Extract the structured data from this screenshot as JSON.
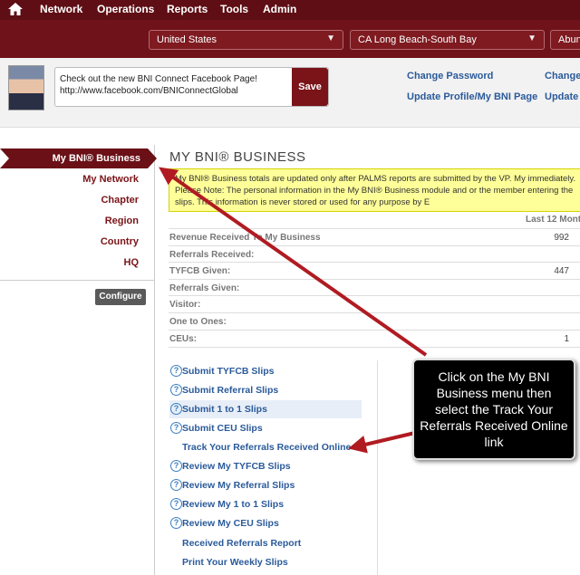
{
  "nav": {
    "items": [
      "Network",
      "Operations",
      "Reports",
      "Tools",
      "Admin"
    ]
  },
  "selectors": [
    {
      "value": "United States"
    },
    {
      "value": "CA Long Beach-South Bay"
    },
    {
      "value": "Abun"
    }
  ],
  "profile": {
    "status_text": "Check out the new BNI Connect Facebook Page!\nhttp://www.facebook.com/BNIConnectGlobal",
    "save_label": "Save",
    "links": [
      "Change Password",
      "Change",
      "Update Profile/My BNI Page",
      "Update I"
    ]
  },
  "sidebar": {
    "active": "My BNI® Business",
    "items": [
      "My Network",
      "Chapter",
      "Region",
      "Country",
      "HQ"
    ],
    "configure_label": "Configure"
  },
  "main": {
    "title": "MY BNI® BUSINESS",
    "notice": "My BNI® Business totals are updated only after PALMS reports are submitted by the VP. My immediately. Please Note: The personal information in the My BNI® Business module and or the member entering the slips. This information is never stored or used for any purpose by E",
    "period_header": "Last 12 Mont",
    "stats": [
      {
        "label": "Revenue Received To My Business",
        "value": "992"
      },
      {
        "label": "Referrals Received:",
        "value": ""
      },
      {
        "label": "TYFCB Given:",
        "value": "447"
      },
      {
        "label": "Referrals Given:",
        "value": ""
      },
      {
        "label": "Visitor:",
        "value": ""
      },
      {
        "label": "One to Ones:",
        "value": ""
      },
      {
        "label": "CEUs:",
        "value": "1"
      }
    ],
    "links": [
      {
        "label": "Submit TYFCB Slips",
        "help": true
      },
      {
        "label": "Submit Referral Slips",
        "help": true
      },
      {
        "label": "Submit 1 to 1 Slips",
        "help": true
      },
      {
        "label": "Submit CEU Slips",
        "help": true
      },
      {
        "label": "Track Your Referrals Received Online",
        "help": false
      },
      {
        "label": "Review My TYFCB Slips",
        "help": true
      },
      {
        "label": "Review My Referral Slips",
        "help": true
      },
      {
        "label": "Review My 1 to 1 Slips",
        "help": true
      },
      {
        "label": "Review My CEU Slips",
        "help": true
      },
      {
        "label": "Received Referrals Report",
        "help": false
      },
      {
        "label": "Print Your Weekly Slips",
        "help": false
      }
    ]
  },
  "callout": {
    "text": "Click on the My BNI Business menu then select the Track Your Referrals Received Online link"
  },
  "colors": {
    "brand": "#6f1219",
    "link": "#2a5a9a",
    "arrow": "#b01b22",
    "notice_bg": "#ffff99"
  }
}
